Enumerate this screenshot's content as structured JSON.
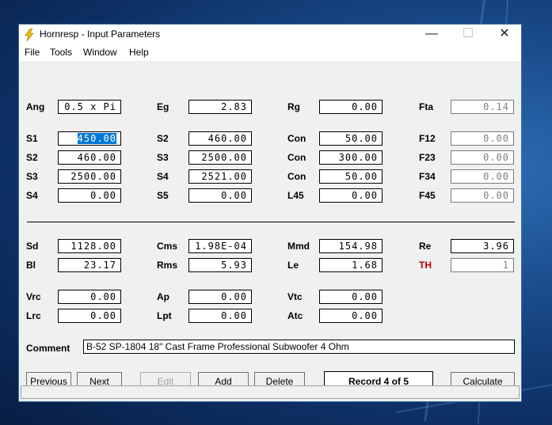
{
  "window": {
    "title": "Hornresp - Input Parameters"
  },
  "menu": [
    "File",
    "Tools",
    "Window",
    "Help"
  ],
  "params": {
    "ang": {
      "label": "Ang",
      "value": "0.5 x Pi"
    },
    "eg": {
      "label": "Eg",
      "value": "2.83"
    },
    "rg": {
      "label": "Rg",
      "value": "0.00"
    },
    "fta": {
      "label": "Fta",
      "value": "0.14"
    },
    "s1": {
      "label": "S1",
      "value": "450.00"
    },
    "s2a": {
      "label": "S2",
      "value": "460.00"
    },
    "con1": {
      "label": "Con",
      "value": "50.00"
    },
    "f12": {
      "label": "F12",
      "value": "0.00"
    },
    "s2b": {
      "label": "S2",
      "value": "460.00"
    },
    "s3a": {
      "label": "S3",
      "value": "2500.00"
    },
    "con2": {
      "label": "Con",
      "value": "300.00"
    },
    "f23": {
      "label": "F23",
      "value": "0.00"
    },
    "s3b": {
      "label": "S3",
      "value": "2500.00"
    },
    "s4a": {
      "label": "S4",
      "value": "2521.00"
    },
    "con3": {
      "label": "Con",
      "value": "50.00"
    },
    "f34": {
      "label": "F34",
      "value": "0.00"
    },
    "s4b": {
      "label": "S4",
      "value": "0.00"
    },
    "s5": {
      "label": "S5",
      "value": "0.00"
    },
    "l45": {
      "label": "L45",
      "value": "0.00"
    },
    "f45": {
      "label": "F45",
      "value": "0.00"
    },
    "sd": {
      "label": "Sd",
      "value": "1128.00"
    },
    "cms": {
      "label": "Cms",
      "value": "1.98E-04"
    },
    "mmd": {
      "label": "Mmd",
      "value": "154.98"
    },
    "re": {
      "label": "Re",
      "value": "3.96"
    },
    "bl": {
      "label": "Bl",
      "value": "23.17"
    },
    "rms": {
      "label": "Rms",
      "value": "5.93"
    },
    "le": {
      "label": "Le",
      "value": "1.68"
    },
    "th": {
      "label": "TH",
      "value": "1"
    },
    "vrc": {
      "label": "Vrc",
      "value": "0.00"
    },
    "ap": {
      "label": "Ap",
      "value": "0.00"
    },
    "vtc": {
      "label": "Vtc",
      "value": "0.00"
    },
    "lrc": {
      "label": "Lrc",
      "value": "0.00"
    },
    "lpt": {
      "label": "Lpt",
      "value": "0.00"
    },
    "atc": {
      "label": "Atc",
      "value": "0.00"
    }
  },
  "comment": {
    "label": "Comment",
    "value": "B-52 SP-1804 18\" Cast Frame Professional Subwoofer 4 Ohm"
  },
  "buttons": {
    "previous": "Previous",
    "next": "Next",
    "edit": "Edit",
    "add": "Add",
    "delete": "Delete",
    "record": "Record 4 of 5",
    "calculate": "Calculate"
  },
  "colors": {
    "selection": "#0078d7",
    "th_label": "#c00000",
    "desktop": "#1a4c8c"
  }
}
